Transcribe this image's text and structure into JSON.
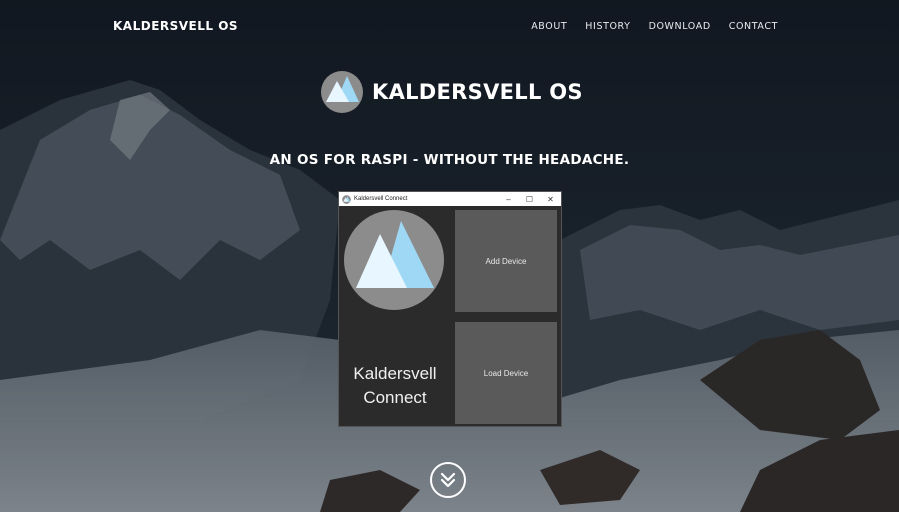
{
  "nav": {
    "brand": "KALDERSVELL OS",
    "links": [
      "ABOUT",
      "HISTORY",
      "DOWNLOAD",
      "CONTACT"
    ]
  },
  "hero": {
    "title": "KALDERSVELL OS",
    "tagline": "AN OS FOR RASPI - WITHOUT THE HEADACHE."
  },
  "app_window": {
    "title": "Kaldersvell Connect",
    "controls": [
      "–",
      "☐",
      "✕"
    ],
    "label_line1": "Kaldersvell",
    "label_line2": "Connect",
    "add_device": "Add Device",
    "load_device": "Load Device"
  },
  "icons": {
    "logo": "mountain-logo-icon",
    "scroll": "chevron-double-down-icon"
  },
  "colors": {
    "logo_circle": "#8c8c8c",
    "logo_peak_light": "#e8f6ff",
    "logo_peak_blue": "#9fd8f5",
    "tile": "#5a5a5a",
    "window_body": "#2b2b2b"
  }
}
